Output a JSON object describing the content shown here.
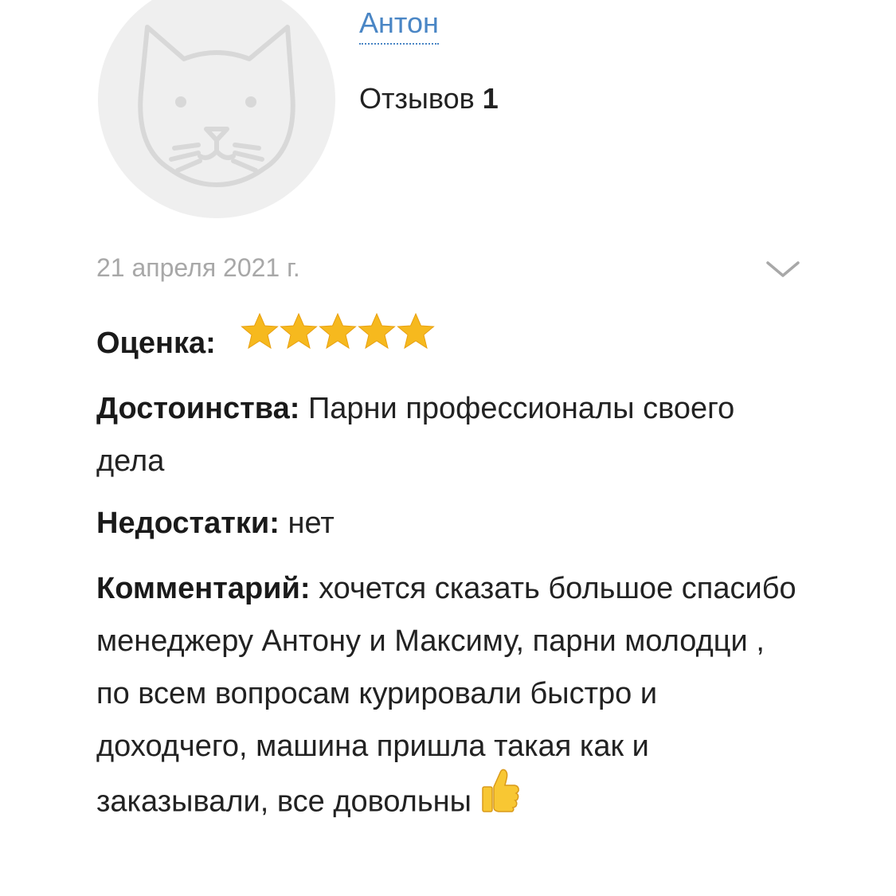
{
  "author": {
    "name": "Антон",
    "reviews_label": "Отзывов",
    "reviews_count": "1",
    "avatar_icon": "cat-avatar-icon"
  },
  "review": {
    "date": "21 апреля 2021 г.",
    "expand_icon": "chevron-down-icon",
    "rating_label": "Оценка:",
    "rating_value": 5,
    "rating_max": 5,
    "pros_label": "Достоинства:",
    "pros_text": "Парни профессионалы своего дела",
    "cons_label": "Недостатки:",
    "cons_text": "нет",
    "comment_label": "Комментарий:",
    "comment_text": "хочется сказать большое спасибо менеджеру Антону и Максиму, парни молодци , по всем вопросам курировали быстро и доходчего, машина пришла такая как и заказывали, все довольны",
    "comment_emoji": "thumbs-up-icon"
  },
  "colors": {
    "link": "#4a86c5",
    "date": "#a8a8a8",
    "star": "#f6b91e",
    "avatar_bg": "#efefef"
  }
}
